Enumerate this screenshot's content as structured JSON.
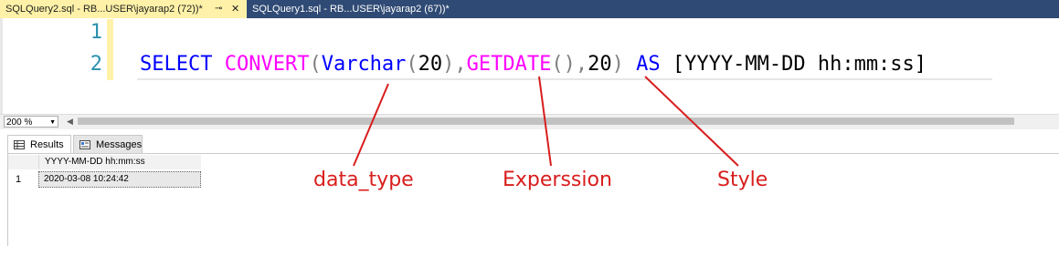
{
  "tabs": [
    {
      "label": "SQLQuery2.sql - RB...USER\\jayarap2 (72))*",
      "pin_glyph": "⊸",
      "close_glyph": "✕"
    },
    {
      "label": "SQLQuery1.sql - RB...USER\\jayarap2 (67))*"
    }
  ],
  "editor": {
    "line_numbers": [
      "1",
      "2"
    ],
    "code": {
      "select": "SELECT",
      "convert": "CONVERT",
      "open1": "(",
      "varchar": "Varchar",
      "open2": "(",
      "num20a": "20",
      "close2": ")",
      "comma1": ",",
      "getdate": "GETDATE",
      "parens": "()",
      "comma2": ",",
      "num20b": "20",
      "close1": ")",
      "as": "AS",
      "alias": "[YYYY-MM-DD hh:mm:ss]"
    }
  },
  "zoom": {
    "value": "200 %"
  },
  "results": {
    "tabs": [
      {
        "label": "Results"
      },
      {
        "label": "Messages"
      }
    ],
    "column_header": "YYYY-MM-DD hh:mm:ss",
    "rows": [
      {
        "row_num": "1",
        "value": "2020-03-08 10:24:42"
      }
    ]
  },
  "annotations": {
    "labels": [
      "data_type",
      "Experssion",
      "Style"
    ],
    "color": "#d81e1e"
  },
  "colors": {
    "keyword": "#0000ff",
    "function": "#ff00ff",
    "operator": "#808080",
    "line_number": "#2b91af",
    "active_tab": "#fff2a8",
    "tab_bar": "#2f4a74"
  }
}
